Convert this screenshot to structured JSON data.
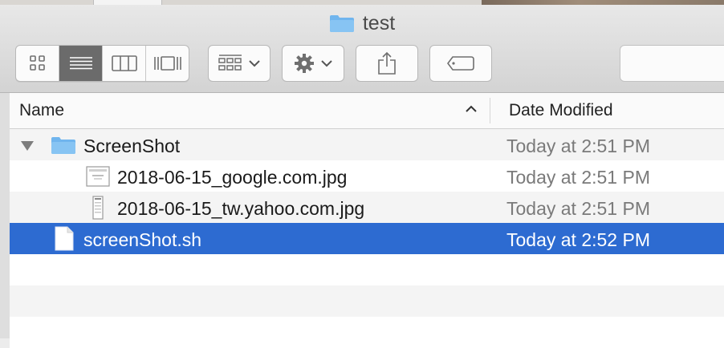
{
  "window": {
    "title": "test"
  },
  "toolbar": {
    "view_modes": [
      {
        "name": "icon-view",
        "icon": "grid-icon",
        "selected": false
      },
      {
        "name": "list-view",
        "icon": "list-icon",
        "selected": true
      },
      {
        "name": "column-view",
        "icon": "columns-icon",
        "selected": false
      },
      {
        "name": "gallery-view",
        "icon": "coverflow-icon",
        "selected": false
      }
    ],
    "group_icon": "group-grid-icon",
    "action_icon": "gear-icon",
    "share_icon": "share-icon",
    "tag_icon": "tag-icon"
  },
  "columns": {
    "name": "Name",
    "date_modified": "Date Modified"
  },
  "files": [
    {
      "name": "ScreenShot",
      "date": "Today at 2:51 PM",
      "kind": "folder",
      "expanded": true
    },
    {
      "name": "2018-06-15_google.com.jpg",
      "date": "Today at 2:51 PM",
      "kind": "image"
    },
    {
      "name": "2018-06-15_tw.yahoo.com.jpg",
      "date": "Today at 2:51 PM",
      "kind": "image"
    },
    {
      "name": "screenShot.sh",
      "date": "Today at 2:52 PM",
      "kind": "script",
      "selected": true
    }
  ],
  "colors": {
    "selection": "#2d6bd1",
    "folder": "#72b4ec"
  }
}
